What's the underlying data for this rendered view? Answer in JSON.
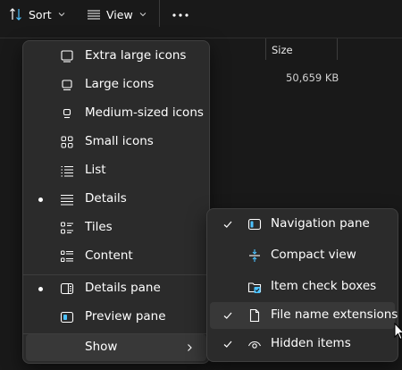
{
  "toolbar": {
    "sort_label": "Sort",
    "view_label": "View",
    "more_label": "More options"
  },
  "columns": {
    "size_header": "Size",
    "size_value": "50,659 KB"
  },
  "view_menu": {
    "items": [
      {
        "label": "Extra large icons",
        "icon": "monitor-large-icon",
        "selected": false
      },
      {
        "label": "Large icons",
        "icon": "monitor-icon",
        "selected": false
      },
      {
        "label": "Medium-sized icons",
        "icon": "monitor-small-icon",
        "selected": false
      },
      {
        "label": "Small icons",
        "icon": "grid-icon",
        "selected": false
      },
      {
        "label": "List",
        "icon": "list-icon",
        "selected": false
      },
      {
        "label": "Details",
        "icon": "details-icon",
        "selected": true
      },
      {
        "label": "Tiles",
        "icon": "tiles-icon",
        "selected": false
      },
      {
        "label": "Content",
        "icon": "content-icon",
        "selected": false
      },
      {
        "label": "Details pane",
        "icon": "details-pane-icon",
        "selected": true
      },
      {
        "label": "Preview pane",
        "icon": "preview-pane-icon",
        "selected": false
      },
      {
        "label": "Show",
        "icon": "",
        "selected": false
      }
    ]
  },
  "show_submenu": {
    "items": [
      {
        "label": "Navigation pane",
        "icon": "navigation-pane-icon",
        "checked": true
      },
      {
        "label": "Compact view",
        "icon": "compact-view-icon",
        "checked": false
      },
      {
        "label": "Item check boxes",
        "icon": "checkbox-folder-icon",
        "checked": false
      },
      {
        "label": "File name extensions",
        "icon": "file-icon",
        "checked": true
      },
      {
        "label": "Hidden items",
        "icon": "eye-icon",
        "checked": true
      }
    ]
  },
  "colors": {
    "background": "#191919",
    "menu": "#2b2b2b",
    "hover": "#383838",
    "accent": "#4cc2ff"
  }
}
